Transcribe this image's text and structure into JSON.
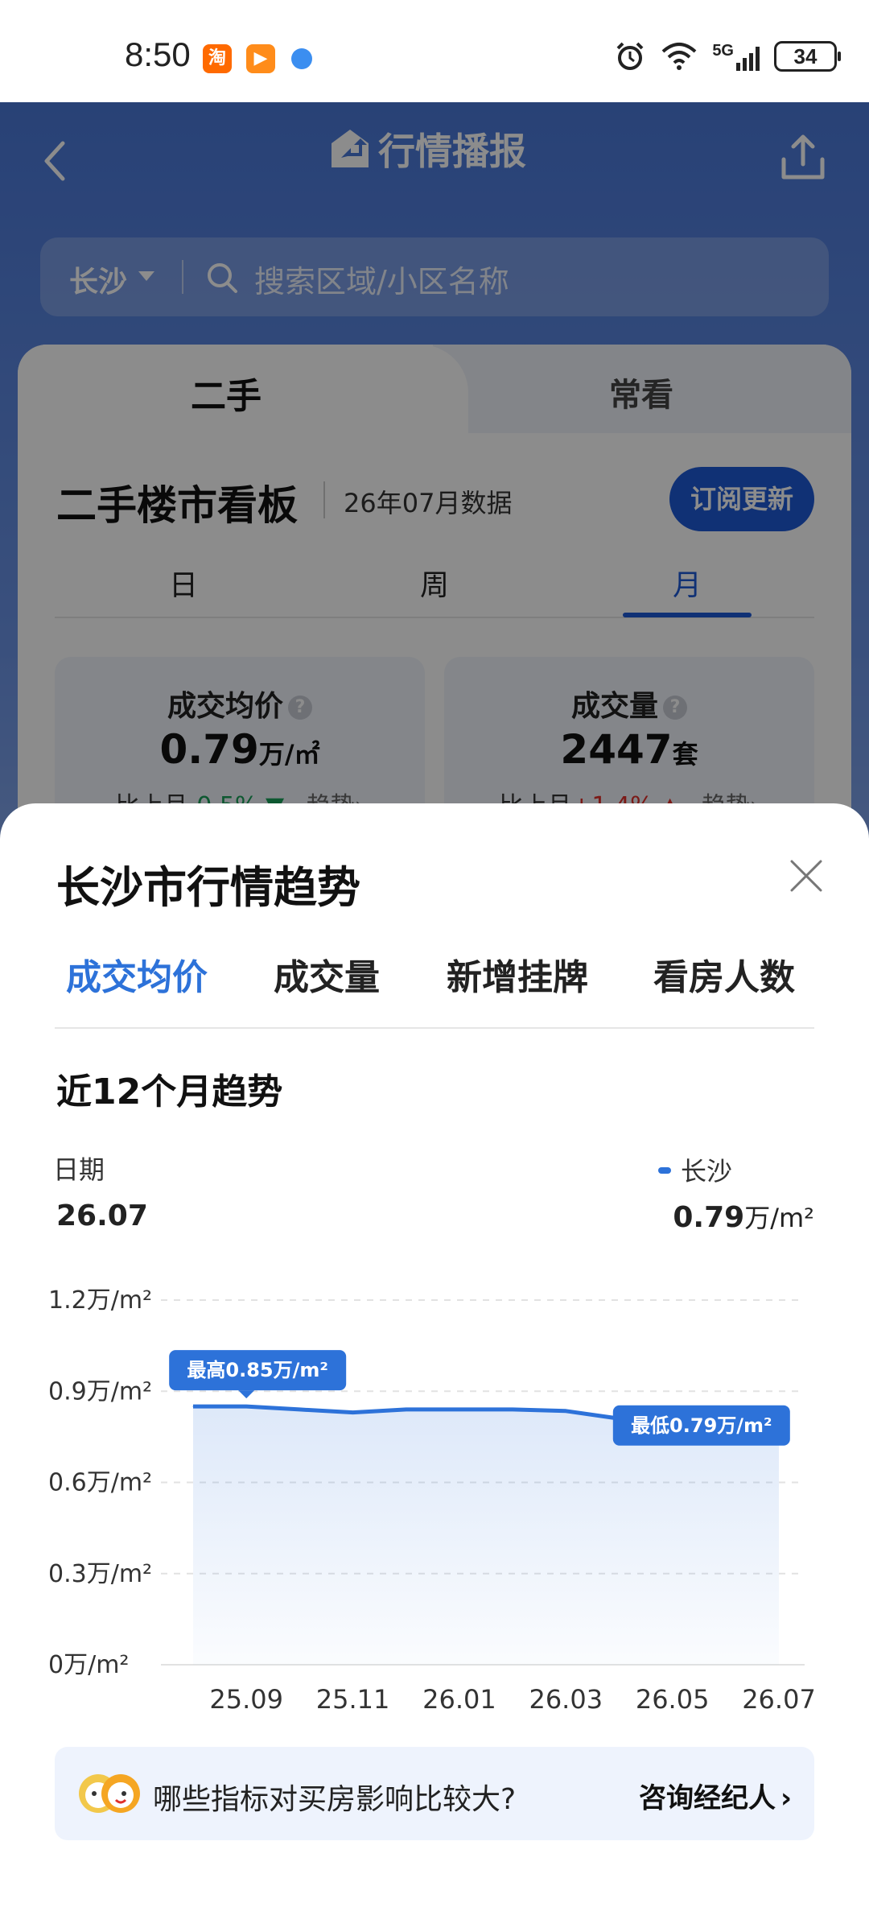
{
  "status_bar": {
    "time": "8:50",
    "apps": [
      {
        "name": "taobao",
        "glyph": "淘",
        "color": "#ff6a00"
      },
      {
        "name": "video",
        "glyph": "▶",
        "color": "#ff8c1a"
      }
    ],
    "network": "5G",
    "battery": "34"
  },
  "nav": {
    "title": "行情播报",
    "back_icon": "chevron-left-icon",
    "share_icon": "share-icon"
  },
  "search": {
    "city": "长沙",
    "placeholder": "搜索区域/小区名称"
  },
  "tabs": {
    "primary": "二手",
    "secondary": "常看"
  },
  "board": {
    "title": "二手楼市看板",
    "data_date": "26年07月数据",
    "subscribe_label": "订阅更新",
    "periods": [
      "日",
      "周",
      "月"
    ],
    "active_period": "月"
  },
  "stats": [
    {
      "label": "成交均价",
      "value": "0.79",
      "unit": "万/㎡",
      "compare_label": "比上月",
      "change": "-0.5%",
      "trend_label": "趋势"
    },
    {
      "label": "成交量",
      "value": "2447",
      "unit": "套",
      "compare_label": "比上月",
      "change": "+1.4%",
      "trend_label": "趋势"
    }
  ],
  "sheet": {
    "title": "长沙市行情趋势",
    "close_icon": "close-icon",
    "metric_tabs": [
      "成交均价",
      "成交量",
      "新增挂牌",
      "看房人数"
    ],
    "active_metric": "成交均价",
    "trend_title": "近12个月趋势",
    "date_label": "日期",
    "date_value": "26.07",
    "legend_name": "长沙",
    "price_number": "0.79",
    "price_unit": "万/m²"
  },
  "chart_data": {
    "type": "area",
    "y_tick_labels": [
      "1.2万/m²",
      "0.9万/m²",
      "0.6万/m²",
      "0.3万/m²",
      "0万/m²"
    ],
    "ylim": [
      0,
      1.2
    ],
    "x_tick_labels": [
      "25.09",
      "25.11",
      "26.01",
      "26.03",
      "26.05",
      "26.07"
    ],
    "x": [
      "25.08",
      "25.09",
      "25.10",
      "25.11",
      "25.12",
      "26.01",
      "26.02",
      "26.03",
      "26.04",
      "26.05",
      "26.06",
      "26.07"
    ],
    "series": [
      {
        "name": "长沙",
        "values": [
          0.85,
          0.85,
          0.84,
          0.83,
          0.84,
          0.84,
          0.84,
          0.835,
          0.81,
          0.8,
          0.795,
          0.79
        ],
        "color": "#2d72d9"
      }
    ],
    "annotations": [
      {
        "label": "最高0.85万/m²",
        "x": "25.09",
        "y": 0.85
      },
      {
        "label": "最低0.79万/m²",
        "x": "26.06",
        "y": 0.79
      }
    ],
    "grid": true
  },
  "advice": {
    "question": "哪些指标对买房影响比较大?",
    "link_label": "咨询经纪人",
    "chevron": "›"
  },
  "colors": {
    "accent": "#2d72d9",
    "nav_blue": "#4a78d8",
    "button_blue": "#1e59d6",
    "down_green": "#1aa05a",
    "up_red": "#e0302a"
  }
}
